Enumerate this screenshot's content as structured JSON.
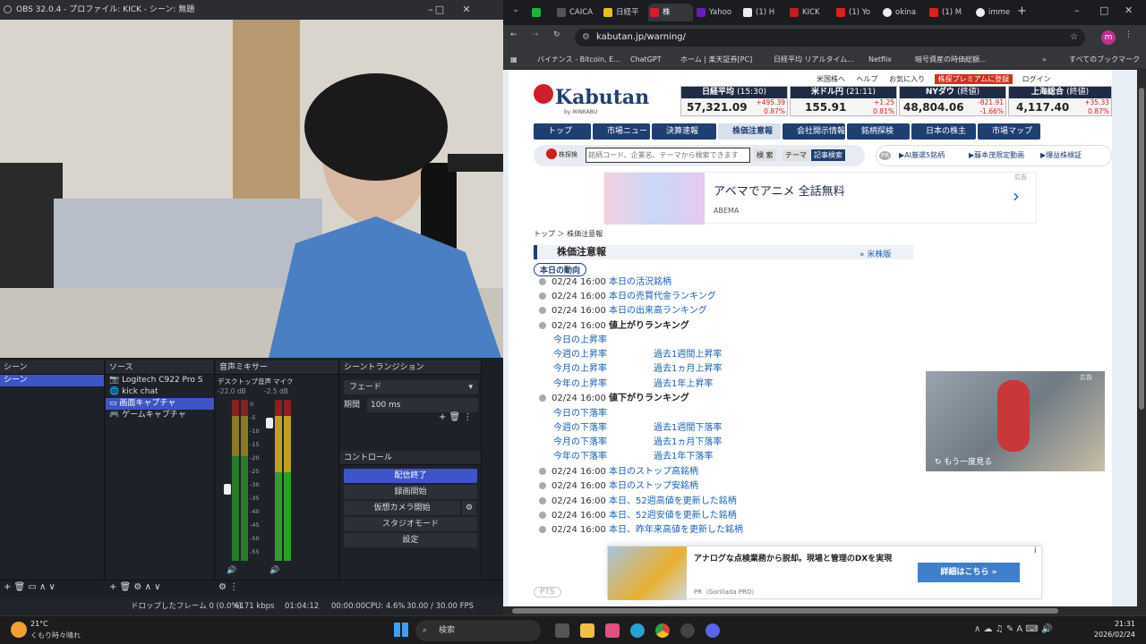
{
  "obs": {
    "title": "OBS 32.0.4 - プロファイル: KICK - シーン: 無題",
    "docks": {
      "scenes": "シーン",
      "sources": "ソース",
      "mixer": "音声ミキサー",
      "transitions": "シーントランジション",
      "controls": "コントロール"
    },
    "scenes": [
      "シーン"
    ],
    "sources": [
      "Logitech C922 Pro S",
      "kick chat",
      "画面キャプチャ",
      "ゲームキャプチャ"
    ],
    "mixer": {
      "ch1": "デスクトップ音声",
      "ch1_db": "-22.0 dB",
      "ch2": "マイク",
      "ch2_db": "-2.5 dB",
      "scale": [
        "0",
        "-5",
        "-10",
        "-15",
        "-20",
        "-25",
        "-30",
        "-35",
        "-40",
        "-45",
        "-50",
        "-55",
        "-60"
      ]
    },
    "transition": {
      "type": "フェード",
      "duration_label": "期間",
      "duration": "100 ms"
    },
    "controls": [
      "配信終了",
      "録画開始",
      "仮想カメラ開始",
      "スタジオモード",
      "設定"
    ],
    "status": {
      "dropped": "ドロップしたフレーム 0 (0.0%)",
      "bitrate": "6171 kbps",
      "live": "01:04:12",
      "rec": "00:00:00",
      "cpu": "CPU: 4.6%",
      "fps": "30.00 / 30.00 FPS"
    }
  },
  "chrome": {
    "tabs": [
      "",
      "CAICA",
      "日経平",
      "株",
      "Yahoo",
      "(1) H",
      "KICK",
      "(1) Yo",
      "okina",
      "(1) M",
      "imme"
    ],
    "url": "kabutan.jp/warning/",
    "bookmarks": [
      "バイナンス - Bitcoin, E...",
      "ChatGPT",
      "ホーム | 楽天証券[PC]",
      "日経平均 リアルタイム...",
      "Netflix",
      "暗号資産の時価総額...",
      "すべてのブックマーク"
    ],
    "avatar": "m"
  },
  "kabutan": {
    "toplinks": [
      "米国株へ",
      "ヘルプ",
      "お気に入り",
      "株探プレミアムに登録",
      "ログイン"
    ],
    "logo": "Kabutan",
    "logo_sub": "by MINKABU",
    "tickers": [
      {
        "name": "日経平均",
        "time": "(15:30)",
        "value": "57,321.09",
        "chg": "+495.39",
        "pct": "0.87%"
      },
      {
        "name": "米ドル円",
        "time": "(21:11)",
        "value": "155.91",
        "chg": "+1.25",
        "pct": "0.81%"
      },
      {
        "name": "NYダウ",
        "time": "(終値)",
        "value": "48,804.06",
        "chg": "-821.91",
        "pct": "-1.66%"
      },
      {
        "name": "上海総合",
        "time": "(終値)",
        "value": "4,117.40",
        "chg": "+35.33",
        "pct": "0.87%"
      }
    ],
    "nav": [
      "トップ",
      "市場ニュース",
      "決算速報",
      "株価注意報",
      "会社開示情報",
      "銘柄探検",
      "日本の株主",
      "市場マップ"
    ],
    "search": {
      "label": "株探検",
      "placeholder": "銘柄コード、企業名、テーマから検索できます",
      "b1": "検 索",
      "b2": "テーマ",
      "b3": "記事検索"
    },
    "pr": {
      "tag": "PR",
      "l1": "▶AI厳選5銘柄",
      "l2": "▶藤本茂限定動画",
      "l3": "▶爆益株検証"
    },
    "ad": {
      "title": "アベマでアニメ 全話無料",
      "brand": "ABEMA",
      "tag": "広告"
    },
    "breadcrumb": "トップ ＞ 株価注意報",
    "heading": "株価注意報",
    "us_link": "» 米株版",
    "today": "本日の動向",
    "items": [
      {
        "t": "02/24 16:00",
        "l": "本日の活況銘柄"
      },
      {
        "t": "02/24 16:00",
        "l": "本日の売買代金ランキング"
      },
      {
        "t": "02/24 16:00",
        "l": "本日の出来高ランキング"
      },
      {
        "t": "02/24 16:00",
        "l": "値上がりランキング",
        "bold": true
      },
      {
        "t": "02/24 16:00",
        "l": "値下がりランキング",
        "bold": true
      },
      {
        "t": "02/24 16:00",
        "l": "本日のストップ高銘柄"
      },
      {
        "t": "02/24 16:00",
        "l": "本日のストップ安銘柄"
      },
      {
        "t": "02/24 16:00",
        "l": "本日、52週高値を更新した銘柄"
      },
      {
        "t": "02/24 16:00",
        "l": "本日、52週安値を更新した銘柄"
      },
      {
        "t": "02/24 16:00",
        "l": "本日、昨年来高値を更新した銘柄"
      }
    ],
    "up": [
      "今日の上昇率",
      "今週の上昇率",
      "過去1週間上昇率",
      "今月の上昇率",
      "過去1ヵ月上昇率",
      "今年の上昇率",
      "過去1年上昇率"
    ],
    "down": [
      "今日の下落率",
      "今週の下落率",
      "過去1週間下落率",
      "今月の下落率",
      "過去1ヵ月下落率",
      "今年の下落率",
      "過去1年下落率"
    ],
    "video_ad": {
      "replay": "もう一度見る",
      "tag": "広告"
    },
    "bottom_ad": {
      "text": "アナログな点検業務から脱却。現場と管理のDXを実現",
      "cta": "詳細はこちら »",
      "src": "PR（Gorillada PRO）"
    },
    "pts": "PTS"
  },
  "taskbar": {
    "temp": "21°C",
    "weather": "くもり時々晴れ",
    "search": "検索",
    "time": "21:31",
    "date": "2026/02/24"
  }
}
